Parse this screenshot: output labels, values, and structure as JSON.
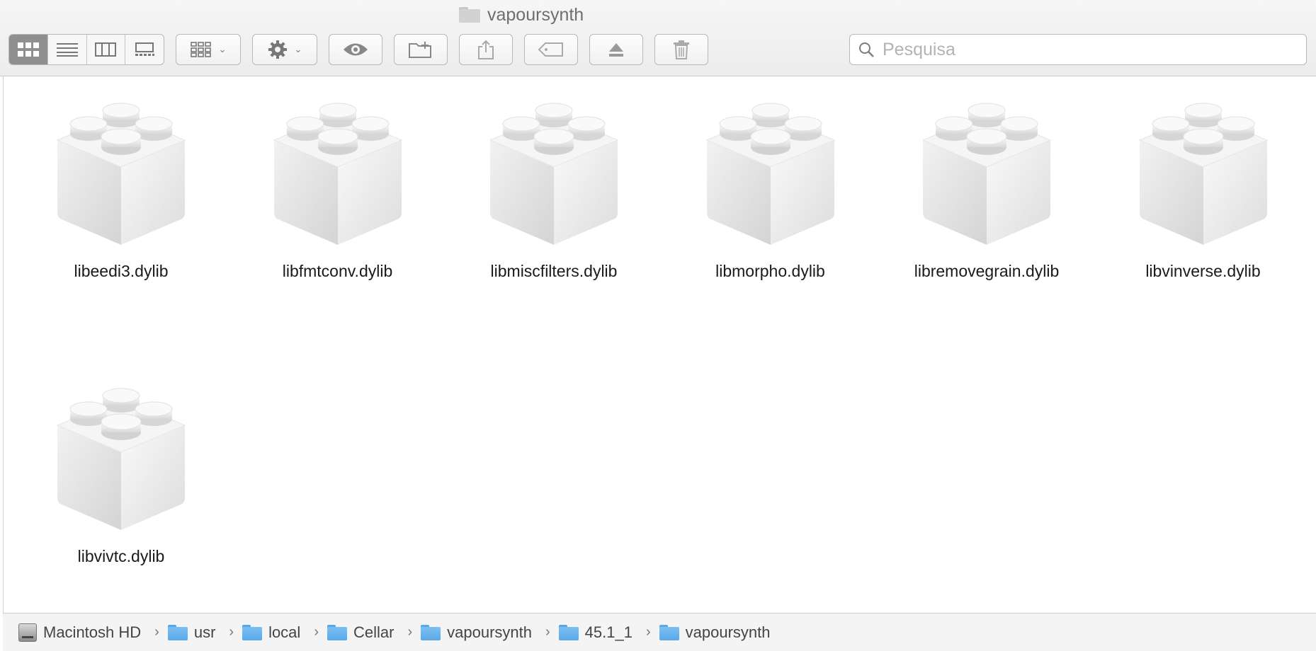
{
  "window": {
    "title": "vapoursynth"
  },
  "toolbar": {
    "view_modes": [
      "icon-view",
      "list-view",
      "column-view",
      "gallery-view"
    ],
    "search_placeholder": "Pesquisa"
  },
  "files": [
    {
      "name": "libeedi3.dylib"
    },
    {
      "name": "libfmtconv.dylib"
    },
    {
      "name": "libmiscfilters.dylib"
    },
    {
      "name": "libmorpho.dylib"
    },
    {
      "name": "libremovegrain.dylib"
    },
    {
      "name": "libvinverse.dylib"
    },
    {
      "name": "libvivtc.dylib"
    }
  ],
  "pathbar": [
    {
      "label": "Macintosh HD",
      "icon": "disk-icon"
    },
    {
      "label": "usr",
      "icon": "folder-icon"
    },
    {
      "label": "local",
      "icon": "folder-icon"
    },
    {
      "label": "Cellar",
      "icon": "folder-icon"
    },
    {
      "label": "vapoursynth",
      "icon": "folder-icon"
    },
    {
      "label": "45.1_1",
      "icon": "folder-icon"
    },
    {
      "label": "vapoursynth",
      "icon": "folder-icon"
    }
  ],
  "colors": {
    "accent": "#5aa8e8",
    "toolbar_bg": "#ececec",
    "active_segment": "#8f8f8f"
  }
}
